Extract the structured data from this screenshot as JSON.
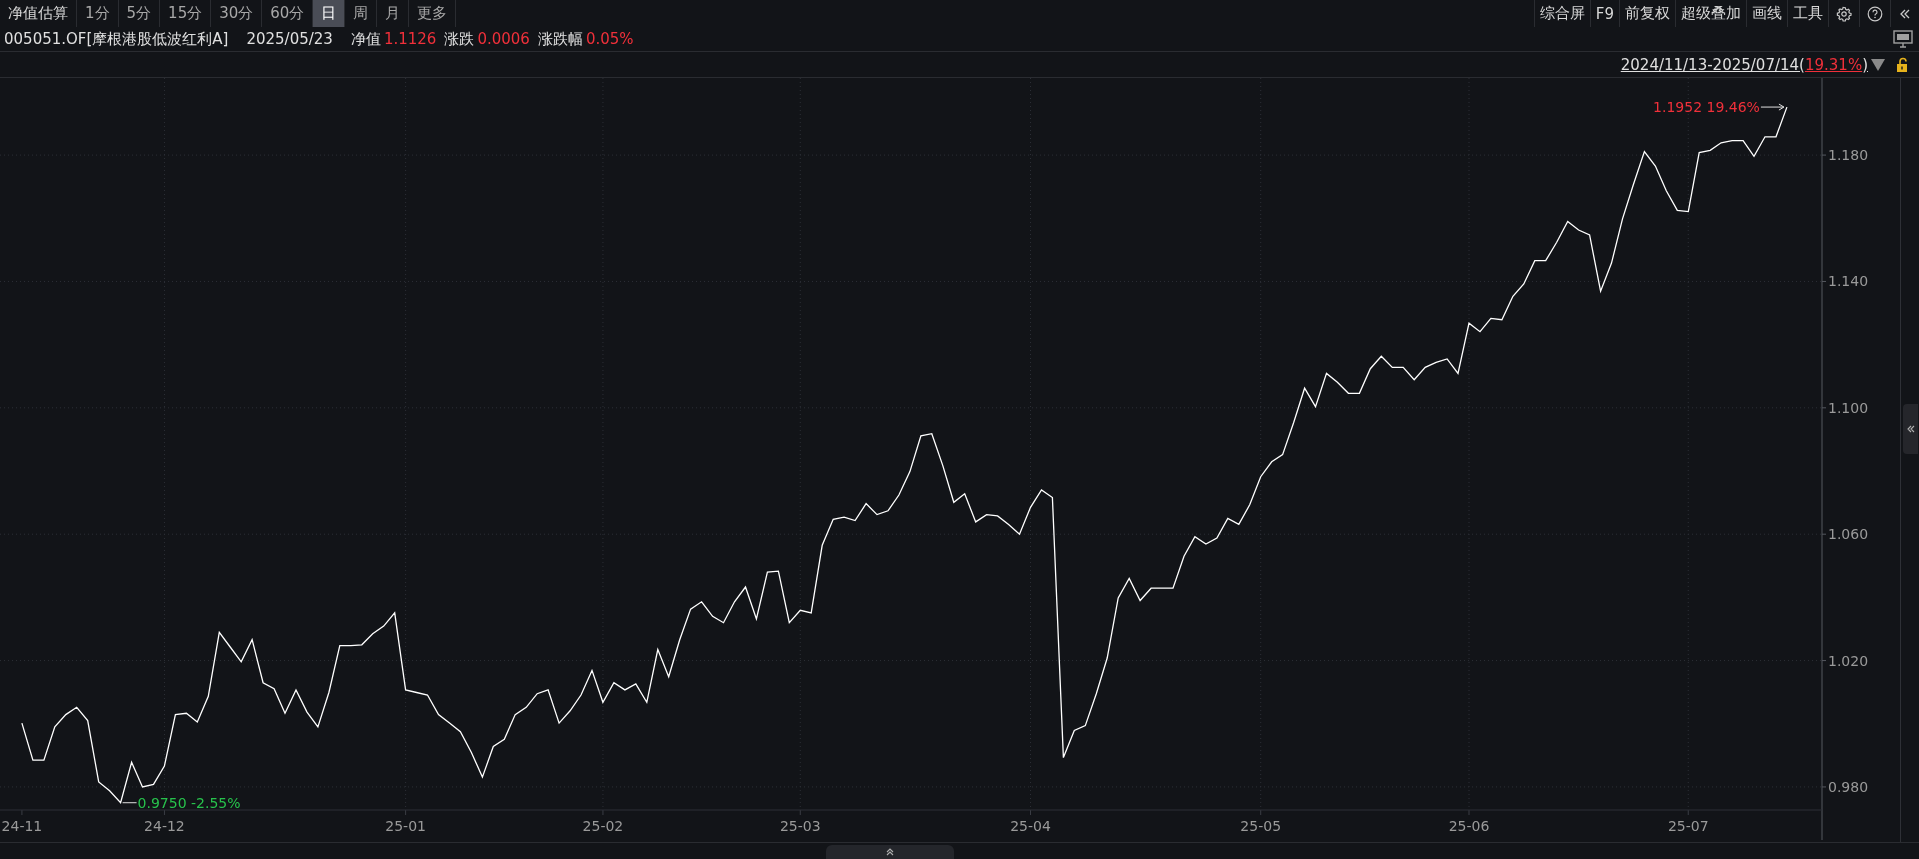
{
  "toolbar": {
    "periods": [
      {
        "label": "净值估算",
        "selected": false
      },
      {
        "label": "1分",
        "selected": false
      },
      {
        "label": "5分",
        "selected": false
      },
      {
        "label": "15分",
        "selected": false
      },
      {
        "label": "30分",
        "selected": false
      },
      {
        "label": "60分",
        "selected": false
      },
      {
        "label": "日",
        "selected": true
      },
      {
        "label": "周",
        "selected": false
      },
      {
        "label": "月",
        "selected": false
      },
      {
        "label": "更多",
        "selected": false
      }
    ],
    "tools": [
      "综合屏",
      "F9",
      "前复权",
      "超级叠加",
      "画线",
      "工具"
    ]
  },
  "info": {
    "code": "005051.OF[摩根港股低波红利A]",
    "date": "2025/05/23",
    "fields": [
      {
        "label": "净值",
        "value": "1.1126"
      },
      {
        "label": "涨跌",
        "value": "0.0006"
      },
      {
        "label": "涨跌幅",
        "value": "0.05%"
      }
    ]
  },
  "range": {
    "dates": "2024/11/13-2025/07/14(",
    "change": "19.31%",
    "close": ")"
  },
  "chart": {
    "chart_data": {
      "type": "line",
      "grid": true,
      "categories": [
        "24-11",
        null,
        null,
        null,
        null,
        null,
        null,
        null,
        null,
        null,
        null,
        null,
        null,
        "24-12",
        null,
        null,
        null,
        null,
        null,
        null,
        null,
        null,
        null,
        null,
        null,
        null,
        null,
        null,
        null,
        null,
        null,
        null,
        null,
        null,
        null,
        "25-01",
        null,
        null,
        null,
        null,
        null,
        null,
        null,
        null,
        null,
        null,
        null,
        null,
        null,
        null,
        null,
        null,
        null,
        "25-02",
        null,
        null,
        null,
        null,
        null,
        null,
        null,
        null,
        null,
        null,
        null,
        null,
        null,
        null,
        null,
        null,
        null,
        "25-03",
        null,
        null,
        null,
        null,
        null,
        null,
        null,
        null,
        null,
        null,
        null,
        null,
        null,
        null,
        null,
        null,
        null,
        null,
        null,
        null,
        "25-04",
        null,
        null,
        null,
        null,
        null,
        null,
        null,
        null,
        null,
        null,
        null,
        null,
        null,
        null,
        null,
        null,
        null,
        null,
        null,
        null,
        "25-05",
        null,
        null,
        null,
        null,
        null,
        null,
        null,
        null,
        null,
        null,
        null,
        null,
        null,
        null,
        null,
        null,
        null,
        null,
        "25-06",
        null,
        null,
        null,
        null,
        null,
        null,
        null,
        null,
        null,
        null,
        null,
        null,
        null,
        null,
        null,
        null,
        null,
        null,
        null,
        "25-07",
        null,
        null,
        null,
        null,
        null,
        null,
        null,
        null,
        null
      ],
      "ylim": [
        0.9727,
        1.2044
      ],
      "yticks": [
        {
          "value": 0.98,
          "label": "0.980"
        },
        {
          "value": 1.02,
          "label": "1.020"
        },
        {
          "value": 1.06,
          "label": "1.060"
        },
        {
          "value": 1.1,
          "label": "1.100"
        },
        {
          "value": 1.14,
          "label": "1.140"
        },
        {
          "value": 1.18,
          "label": "1.180"
        }
      ],
      "series": [
        {
          "color": "#ffffff",
          "values": [
            1.0002,
            0.9885,
            0.9885,
            0.999,
            1.0029,
            1.0052,
            1.001,
            0.9816,
            0.9788,
            0.975,
            0.9878,
            0.98,
            0.9808,
            0.9866,
            1.0029,
            1.0033,
            1.0006,
            1.0087,
            1.0289,
            1.0243,
            1.0196,
            1.0266,
            1.013,
            1.0111,
            1.0033,
            1.0107,
            1.0037,
            0.999,
            1.0099,
            1.0247,
            1.0247,
            1.025,
            1.0285,
            1.0309,
            1.0351,
            1.0107,
            1.0099,
            1.0091,
            1.0029,
            1.0002,
            0.9975,
            0.9909,
            0.9831,
            0.9928,
            0.9951,
            1.0029,
            1.0052,
            1.0095,
            1.0107,
            1.0002,
            1.0041,
            1.0091,
            1.0169,
            1.0068,
            1.013,
            1.0107,
            1.0126,
            1.0068,
            1.0235,
            1.0149,
            1.0266,
            1.0363,
            1.0386,
            1.034,
            1.032,
            1.0386,
            1.0433,
            1.0332,
            1.048,
            1.0483,
            1.032,
            1.0359,
            1.0351,
            1.0565,
            1.0647,
            1.0654,
            1.0643,
            1.0697,
            1.0662,
            1.0674,
            1.0724,
            1.0798,
            1.0911,
            1.0918,
            1.0817,
            1.0701,
            1.0728,
            1.0639,
            1.0662,
            1.0658,
            1.0631,
            1.06,
            1.0685,
            1.074,
            1.0716,
            0.9893,
            0.9979,
            0.9994,
            1.0095,
            1.0208,
            1.0398,
            1.046,
            1.039,
            1.0429,
            1.0429,
            1.0429,
            1.053,
            1.0592,
            1.0569,
            1.0588,
            1.065,
            1.0631,
            1.0693,
            1.0782,
            1.0829,
            1.0852,
            1.0953,
            1.1062,
            1.1004,
            1.1109,
            1.1081,
            1.1046,
            1.1046,
            1.1124,
            1.1163,
            1.1128,
            1.1128,
            1.1089,
            1.1128,
            1.1144,
            1.1155,
            1.1109,
            1.1268,
            1.1241,
            1.1283,
            1.1279,
            1.1353,
            1.1392,
            1.1466,
            1.1466,
            1.1524,
            1.159,
            1.1563,
            1.1547,
            1.1369,
            1.1458,
            1.1598,
            1.1707,
            1.1811,
            1.1765,
            1.1687,
            1.1625,
            1.1621,
            1.1808,
            1.1815,
            1.1839,
            1.1846,
            1.1846,
            1.1796,
            1.1858,
            1.1858,
            1.1952
          ]
        }
      ],
      "annotations": [
        "1.1952 19.46%",
        "0.9750 -2.55%"
      ]
    }
  }
}
